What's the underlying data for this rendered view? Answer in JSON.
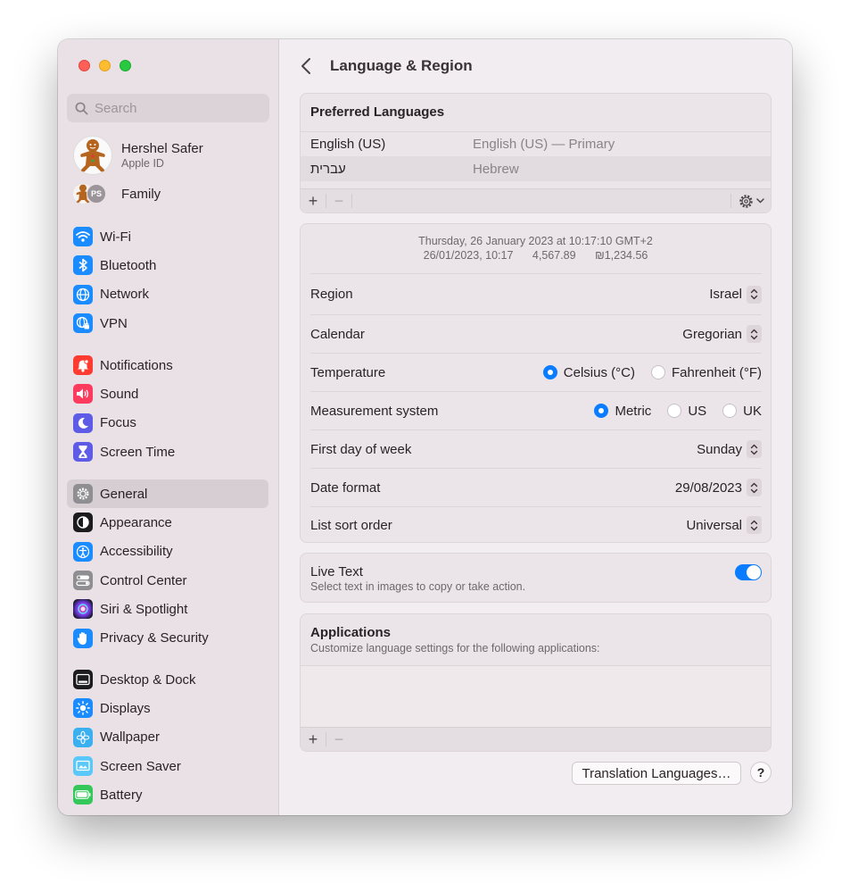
{
  "search": {
    "placeholder": "Search"
  },
  "profile": {
    "name": "Hershel Safer",
    "sub": "Apple ID"
  },
  "family": {
    "label": "Family",
    "initials": "PS"
  },
  "sidebar": {
    "group1": [
      {
        "label": "Wi-Fi",
        "icon": "wifi-icon",
        "color": "#1a8cff"
      },
      {
        "label": "Bluetooth",
        "icon": "bluetooth-icon",
        "color": "#1a8cff"
      },
      {
        "label": "Network",
        "icon": "globe-icon",
        "color": "#1a8cff"
      },
      {
        "label": "VPN",
        "icon": "vpn-globe-icon",
        "color": "#1a8cff"
      }
    ],
    "group2": [
      {
        "label": "Notifications",
        "icon": "bell-icon",
        "color": "#fe3b30"
      },
      {
        "label": "Sound",
        "icon": "speaker-icon",
        "color": "#fe3b5f"
      },
      {
        "label": "Focus",
        "icon": "moon-icon",
        "color": "#5e5ce6"
      },
      {
        "label": "Screen Time",
        "icon": "hourglass-icon",
        "color": "#5e5ce6"
      }
    ],
    "group3": [
      {
        "label": "General",
        "icon": "gear-icon",
        "color": "#8e8e93"
      },
      {
        "label": "Appearance",
        "icon": "appearance-icon",
        "color": "#1c1c1e"
      },
      {
        "label": "Accessibility",
        "icon": "accessibility-icon",
        "color": "#1a8cff"
      },
      {
        "label": "Control Center",
        "icon": "switches-icon",
        "color": "#8e8e93"
      },
      {
        "label": "Siri & Spotlight",
        "icon": "siri-icon",
        "color": "#c043d6"
      },
      {
        "label": "Privacy & Security",
        "icon": "hand-icon",
        "color": "#1a8cff"
      }
    ],
    "group4": [
      {
        "label": "Desktop & Dock",
        "icon": "dock-icon",
        "color": "#1c1c1e"
      },
      {
        "label": "Displays",
        "icon": "sun-icon",
        "color": "#1a8cff"
      },
      {
        "label": "Wallpaper",
        "icon": "flower-icon",
        "color": "#3ab0f0"
      },
      {
        "label": "Screen Saver",
        "icon": "screensaver-icon",
        "color": "#5ac8fa"
      },
      {
        "label": "Battery",
        "icon": "battery-icon",
        "color": "#34c759"
      }
    ]
  },
  "main": {
    "title": "Language & Region",
    "preferred": {
      "heading": "Preferred Languages",
      "rows": [
        {
          "name": "English (US)",
          "desc": "English (US) — Primary"
        },
        {
          "name": "עברית",
          "desc": "Hebrew"
        }
      ],
      "add": "+",
      "remove": "−"
    },
    "sample": {
      "line1": "Thursday, 26 January 2023 at 10:17:10 GMT+2",
      "date": "26/01/2023, 10:17",
      "number": "4,567.89",
      "currency": "₪1,234.56"
    },
    "region": {
      "label": "Region",
      "value": "Israel"
    },
    "calendar": {
      "label": "Calendar",
      "value": "Gregorian"
    },
    "temperature": {
      "label": "Temperature",
      "opt1": "Celsius (°C)",
      "opt2": "Fahrenheit (°F)",
      "selected": "Celsius (°C)"
    },
    "measurement": {
      "label": "Measurement system",
      "opt1": "Metric",
      "opt2": "US",
      "opt3": "UK",
      "selected": "Metric"
    },
    "firstday": {
      "label": "First day of week",
      "value": "Sunday"
    },
    "dateformat": {
      "label": "Date format",
      "value": "29/08/2023"
    },
    "sortorder": {
      "label": "List sort order",
      "value": "Universal"
    },
    "livetext": {
      "label": "Live Text",
      "desc": "Select text in images to copy or take action.",
      "on": true
    },
    "apps": {
      "heading": "Applications",
      "desc": "Customize language settings for the following applications:",
      "add": "+",
      "remove": "−"
    },
    "translation_button": "Translation Languages…",
    "help": "?"
  }
}
